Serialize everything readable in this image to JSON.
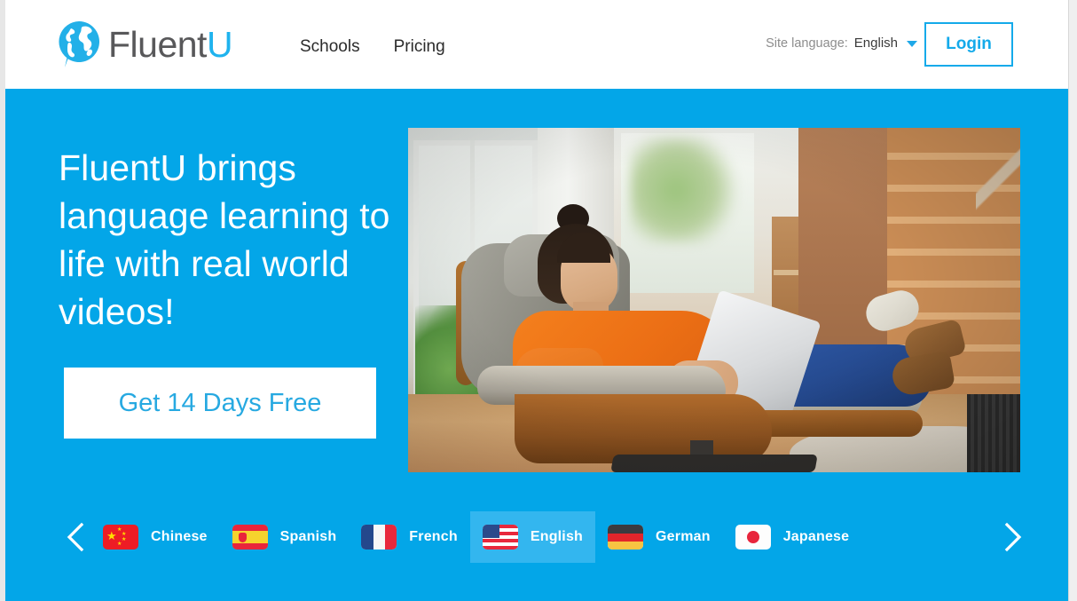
{
  "brand": {
    "name_part1": "Fluent",
    "name_part2": "U",
    "logo_icon": "globe-speech-bubble-icon"
  },
  "header": {
    "nav": [
      {
        "label": "Schools",
        "name": "nav-schools"
      },
      {
        "label": "Pricing",
        "name": "nav-pricing"
      }
    ],
    "site_language": {
      "label": "Site language:",
      "value": "English",
      "caret_icon": "chevron-down-icon"
    },
    "login_label": "Login"
  },
  "hero": {
    "headline": "FluentU brings language learning to life with real world videos!",
    "cta_label": "Get 14 Days Free",
    "image_alt": "Woman in orange top relaxing in a lounge chair using a tablet at home"
  },
  "language_carousel": {
    "prev_icon": "chevron-left-icon",
    "next_icon": "chevron-right-icon",
    "items": [
      {
        "label": "Chinese",
        "flag": "flag-china-icon",
        "active": false
      },
      {
        "label": "Spanish",
        "flag": "flag-spain-icon",
        "active": false
      },
      {
        "label": "French",
        "flag": "flag-france-icon",
        "active": false
      },
      {
        "label": "English",
        "flag": "flag-usa-icon",
        "active": true
      },
      {
        "label": "German",
        "flag": "flag-germany-icon",
        "active": false
      },
      {
        "label": "Japanese",
        "flag": "flag-japan-icon",
        "active": false
      }
    ]
  },
  "colors": {
    "brand_blue": "#03a6e8",
    "accent_blue": "#14aaea",
    "active_item_blue": "#33b6ef",
    "logo_gray": "#58585a"
  }
}
